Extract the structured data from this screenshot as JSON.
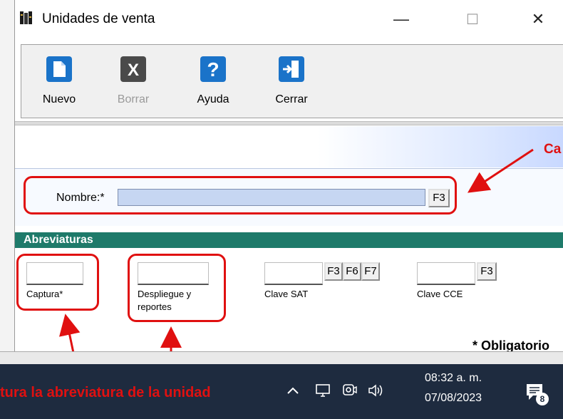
{
  "window": {
    "title": "Unidades de venta",
    "minimize": "—",
    "maximize": "☐",
    "close": "✕"
  },
  "toolbar": {
    "items": [
      {
        "label": "Nuevo",
        "icon": "new-document-icon",
        "color": "#1a73c9",
        "enabled": true
      },
      {
        "label": "Borrar",
        "icon": "delete-x-icon",
        "color": "#4a4a4a",
        "enabled": false
      },
      {
        "label": "Ayuda",
        "icon": "help-question-icon",
        "color": "#1a73c9",
        "enabled": true
      },
      {
        "label": "Cerrar",
        "icon": "exit-door-icon",
        "color": "#1a73c9",
        "enabled": true
      }
    ]
  },
  "form": {
    "nombre_label": "Nombre:*",
    "nombre_value": "",
    "f3": "F3",
    "f6": "F6",
    "f7": "F7"
  },
  "abreviaturas": {
    "title": "Abreviaturas",
    "captura_label": "Captura*",
    "despliegue_label_1": "Despliegue y",
    "despliegue_label_2": "reportes",
    "clave_sat_label": "Clave SAT",
    "clave_cce_label": "Clave CCE"
  },
  "footer": {
    "obligatorio": "* Obligatorio"
  },
  "annotations": {
    "right_label": "Ca",
    "bottom_text": "tura la abreviatura de la unidad",
    "color": "#e01010"
  },
  "taskbar": {
    "time": "08:32 a. m.",
    "date": "07/08/2023",
    "notification_count": "8",
    "bg_color": "#1e2b3f"
  }
}
